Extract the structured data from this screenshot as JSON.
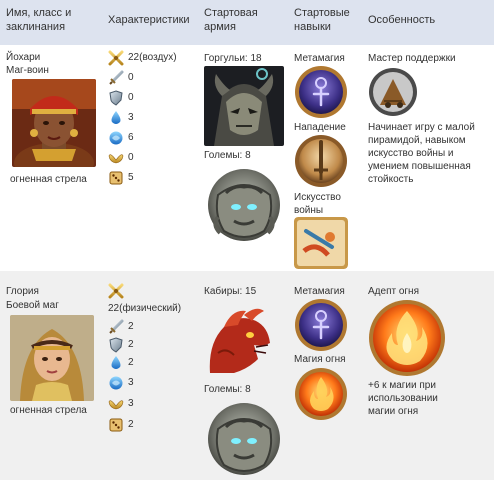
{
  "columns": [
    "Имя, класс и заклинания",
    "Характеристики",
    "Стартовая армия",
    "Стартовые навыки",
    "Особенность"
  ],
  "heroes": [
    {
      "name": "Йохари",
      "class": "Маг-воин",
      "spell": "огненная стрела",
      "stats": [
        {
          "icon": "crossed-swords-icon",
          "value": "22(воздух)"
        },
        {
          "icon": "sword-icon",
          "value": "0"
        },
        {
          "icon": "shield-icon",
          "value": "0"
        },
        {
          "icon": "magic-drop-icon",
          "value": "3"
        },
        {
          "icon": "knowledge-orb-icon",
          "value": "6"
        },
        {
          "icon": "morale-wings-icon",
          "value": "0"
        },
        {
          "icon": "luck-dice-icon",
          "value": "5"
        }
      ],
      "army": [
        {
          "unit": "Горгульи: 18",
          "icon": "gargoyle-icon"
        },
        {
          "unit": "Големы: 8",
          "icon": "golem-icon"
        }
      ],
      "skills": [
        "Метамагия",
        "Нападение",
        "Искусство войны"
      ],
      "feature_title": "Мастер поддержки",
      "feature_desc": "Начинает игру с малой пирамидой, навыком искусство войны и умением повышенная стойкость"
    },
    {
      "name": "Глория",
      "class": "Боевой маг",
      "spell": "огненная стрела",
      "stats": [
        {
          "icon": "crossed-swords-icon",
          "value": "22(физический)"
        },
        {
          "icon": "sword-icon",
          "value": "2"
        },
        {
          "icon": "shield-icon",
          "value": "2"
        },
        {
          "icon": "magic-drop-icon",
          "value": "2"
        },
        {
          "icon": "knowledge-orb-icon",
          "value": "3"
        },
        {
          "icon": "morale-wings-icon",
          "value": "3"
        },
        {
          "icon": "luck-dice-icon",
          "value": "2"
        }
      ],
      "army": [
        {
          "unit": "Кабиры: 15",
          "icon": "kabir-icon"
        },
        {
          "unit": "Големы: 8",
          "icon": "golem-icon"
        }
      ],
      "skills": [
        "Метамагия",
        "Магия огня"
      ],
      "feature_title": "Адепт огня",
      "feature_desc": "+6 к магии при использовании магии огня"
    }
  ],
  "colors": {
    "header_bg": "#dde3ef",
    "row2_bg": "#f0f0f0",
    "text": "#333333"
  }
}
